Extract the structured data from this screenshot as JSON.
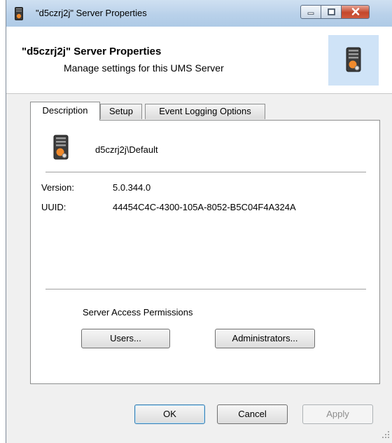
{
  "window": {
    "title": "\"d5czrj2j\" Server Properties",
    "caption_buttons": [
      "minimize",
      "maximize",
      "close"
    ]
  },
  "header": {
    "title": "\"d5czrj2j\" Server Properties",
    "subtitle": "Manage settings for this UMS Server",
    "icon": "server-icon"
  },
  "tabs": [
    {
      "label": "Description",
      "active": true
    },
    {
      "label": "Setup",
      "active": false
    },
    {
      "label": "Event Logging Options",
      "active": false
    }
  ],
  "description": {
    "server_name": "d5czrj2j\\Default",
    "version_label": "Version:",
    "version_value": "5.0.344.0",
    "uuid_label": "UUID:",
    "uuid_value": "44454C4C-4300-105A-8052-B5C04F4A324A",
    "permissions_label": "Server Access Permissions",
    "users_button": "Users...",
    "administrators_button": "Administrators..."
  },
  "footer": {
    "ok_button": "OK",
    "cancel_button": "Cancel",
    "apply_button": "Apply"
  },
  "colors": {
    "titlebar": "#b9d1ea",
    "header_icon_bg": "#cfe3f7",
    "dialog_bg": "#f0f0f0",
    "close_button": "#c4472b",
    "server_icon_accent": "#f08a2c"
  }
}
